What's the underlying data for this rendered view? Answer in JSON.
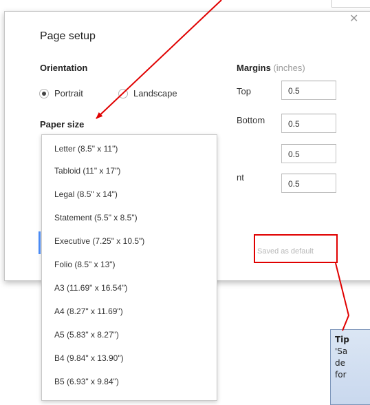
{
  "dialog": {
    "title": "Page setup",
    "close_glyph": "✕",
    "orientation": {
      "label": "Orientation",
      "options": [
        {
          "label": "Portrait",
          "selected": true
        },
        {
          "label": "Landscape",
          "selected": false
        }
      ]
    },
    "paper_size_label": "Paper size",
    "margins": {
      "label": "Margins",
      "unit": "(inches)",
      "fields": [
        {
          "label": "Top",
          "value": "0.5"
        },
        {
          "label": "Bottom",
          "value": "0.5"
        },
        {
          "label": "",
          "value": "0.5"
        },
        {
          "label": "nt",
          "value": "0.5"
        }
      ]
    },
    "saved_default": "Saved as default"
  },
  "paper_sizes": [
    "Letter (8.5\" x 11\")",
    "Tabloid (11\" x 17\")",
    "Legal (8.5\" x 14\")",
    "Statement (5.5\" x 8.5\")",
    "Executive (7.25\" x 10.5\")",
    "Folio (8.5\" x 13\")",
    "A3 (11.69\" x 16.54\")",
    "A4 (8.27\" x 11.69\")",
    "A5 (5.83\" x 8.27\")",
    "B4 (9.84\" x 13.90\")",
    "B5 (6.93\" x 9.84\")"
  ],
  "tip": {
    "title": "Tip",
    "lines": [
      "'Sa",
      "de",
      "for"
    ]
  },
  "annotation_color": "#e00000",
  "accent_color": "#4d90fe"
}
